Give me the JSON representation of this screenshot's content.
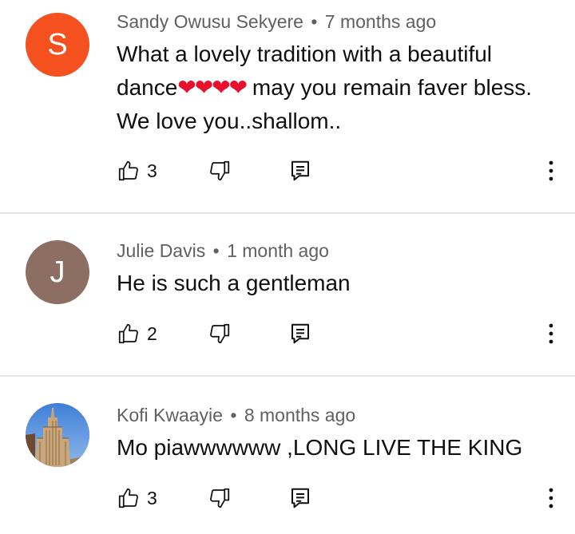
{
  "comments": [
    {
      "avatar_letter": "S",
      "avatar_color": "#f4511e",
      "author": "Sandy Owusu Sekyere",
      "separator": "•",
      "time": "7 months ago",
      "text_before": "What a lovely tradition with a beautiful dance",
      "hearts": "❤❤❤❤",
      "text_after": " may you remain faver bless. We love you..shallom..",
      "likes": "3"
    },
    {
      "avatar_letter": "J",
      "avatar_color": "#8d6e63",
      "author": "Julie Davis",
      "separator": "•",
      "time": "1 month ago",
      "text": "He is such a gentleman",
      "likes": "2"
    },
    {
      "avatar_image": "empire-state-building-photo",
      "author": "Kofi Kwaayie",
      "separator": "•",
      "time": "8 months ago",
      "text": "Mo piawwwwww ,LONG LIVE THE KING",
      "likes": "3"
    }
  ],
  "icons": {
    "like": "thumbs-up-icon",
    "dislike": "thumbs-down-icon",
    "reply": "reply-icon",
    "more": "more-vertical-icon"
  },
  "colors": {
    "heart": "#e8112d",
    "meta_text": "#606060",
    "divider": "#e5e5e5"
  }
}
